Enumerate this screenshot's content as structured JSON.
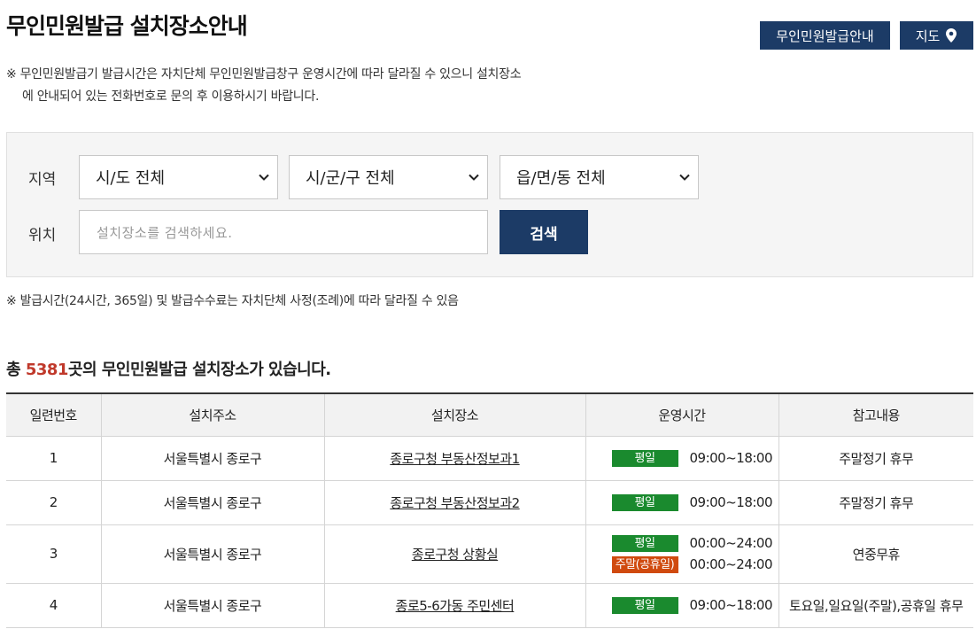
{
  "header": {
    "title": "무인민원발급 설치장소안내",
    "guide_button": "무인민원발급안내",
    "map_button": "지도"
  },
  "notice": {
    "line1": "※ 무인민원발급기 발급시간은 자치단체 무인민원발급창구 운영시간에 따라 달라질 수 있으니 설치장소",
    "line2": "에 안내되어 있는 전화번호로 문의 후 이용하시기 바랍니다."
  },
  "search": {
    "region_label": "지역",
    "location_label": "위치",
    "sido_select": "시/도 전체",
    "sigungu_select": "시/군/구 전체",
    "eupmyeondong_select": "읍/면/동 전체",
    "placeholder": "설치장소를 검색하세요.",
    "button": "검색"
  },
  "notice2": "※ 발급시간(24시간, 365일) 및 발급수수료는 자치단체 사정(조례)에 따라 달라질 수 있음",
  "summary": {
    "prefix": "총 ",
    "count": "5381",
    "suffix": "곳의 무인민원발급 설치장소가 있습니다."
  },
  "table": {
    "headers": [
      "일련번호",
      "설치주소",
      "설치장소",
      "운영시간",
      "참고내용"
    ],
    "rows": [
      {
        "no": "1",
        "address": "서울특별시 종로구",
        "place": "종로구청 부동산정보과1",
        "hours": [
          {
            "badge": "평일",
            "time": "09:00~18:00"
          }
        ],
        "note": "주말정기 휴무"
      },
      {
        "no": "2",
        "address": "서울특별시 종로구",
        "place": "종로구청 부동산정보과2",
        "hours": [
          {
            "badge": "평일",
            "time": "09:00~18:00"
          }
        ],
        "note": "주말정기 휴무"
      },
      {
        "no": "3",
        "address": "서울특별시 종로구",
        "place": "종로구청 상황실",
        "hours": [
          {
            "badge": "평일",
            "time": "00:00~24:00"
          },
          {
            "badge": "주말(공휴일)",
            "time": "00:00~24:00"
          }
        ],
        "note": "연중무휴"
      },
      {
        "no": "4",
        "address": "서울특별시 종로구",
        "place": "종로5-6가동 주민센터",
        "hours": [
          {
            "badge": "평일",
            "time": "09:00~18:00"
          }
        ],
        "note": "토요일,일요일(주말),공휴일 휴무"
      }
    ]
  },
  "colors": {
    "primary": "#1c3b66",
    "weekday_badge": "#1a8a2e",
    "weekend_badge": "#d04a0e",
    "count_highlight": "#c0392b"
  },
  "icons": {
    "map_button_icon": "map-pin-icon",
    "select_icon": "chevron-down-icon"
  }
}
